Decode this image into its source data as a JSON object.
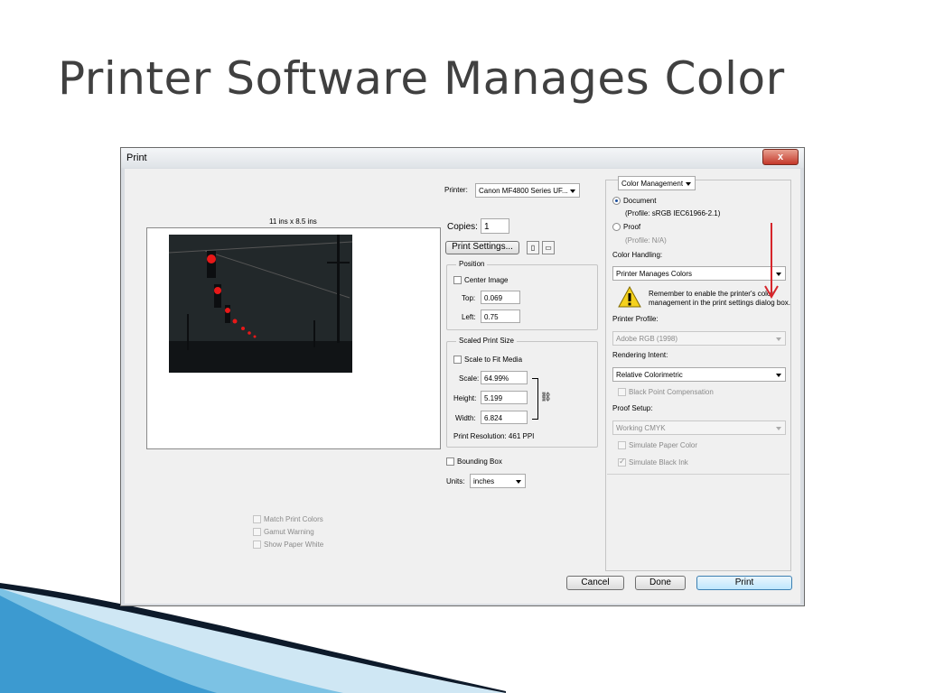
{
  "slide": {
    "title": "Printer Software Manages Color"
  },
  "dialog": {
    "title": "Print",
    "close_glyph": "x",
    "preview": {
      "size_label": "11 ins x 8.5 ins"
    },
    "printer": {
      "label": "Printer:",
      "value": "Canon MF4800 Series UF..."
    },
    "copies": {
      "label": "Copies:",
      "value": "1"
    },
    "print_settings_label": "Print Settings...",
    "position": {
      "title": "Position",
      "center_image_label": "Center Image",
      "top_label": "Top:",
      "top_value": "0.069",
      "left_label": "Left:",
      "left_value": "0.75"
    },
    "scaled_print_size": {
      "title": "Scaled Print Size",
      "scale_to_fit_label": "Scale to Fit Media",
      "scale_label": "Scale:",
      "scale_value": "64.99%",
      "height_label": "Height:",
      "height_value": "5.199",
      "width_label": "Width:",
      "width_value": "6.824",
      "resolution": "Print Resolution: 461 PPI"
    },
    "bounding_box_label": "Bounding Box",
    "units": {
      "label": "Units:",
      "value": "inches"
    },
    "match_print_colors_label": "Match Print Colors",
    "gamut_warning_label": "Gamut Warning",
    "show_paper_white_label": "Show Paper White",
    "color_management": {
      "dropdown_value": "Color Management",
      "document_label": "Document",
      "document_profile": "(Profile: sRGB IEC61966-2.1)",
      "proof_label": "Proof",
      "proof_profile": "(Profile: N/A)",
      "color_handling_label": "Color Handling:",
      "color_handling_value": "Printer Manages Colors",
      "warning_text_line1": "Remember to enable the printer's color",
      "warning_text_line2": "management in the print settings dialog box.",
      "printer_profile_label": "Printer Profile:",
      "printer_profile_value": "Adobe RGB (1998)",
      "rendering_intent_label": "Rendering Intent:",
      "rendering_intent_value": "Relative Colorimetric",
      "black_point_label": "Black Point Compensation",
      "proof_setup_label": "Proof Setup:",
      "proof_setup_value": "Working CMYK",
      "simulate_paper_label": "Simulate Paper Color",
      "simulate_ink_label": "Simulate Black Ink"
    },
    "buttons": {
      "cancel": "Cancel",
      "done": "Done",
      "print": "Print"
    }
  },
  "colors": {
    "arrow": "#d6252b",
    "title": "#404040",
    "swoosh_dark": "#0d1a2a",
    "swoosh_light": "#3c9ad0"
  },
  "icons": [
    "close-icon",
    "warning-icon",
    "red-arrow-icon",
    "link-icon",
    "page-orientation-icon"
  ]
}
